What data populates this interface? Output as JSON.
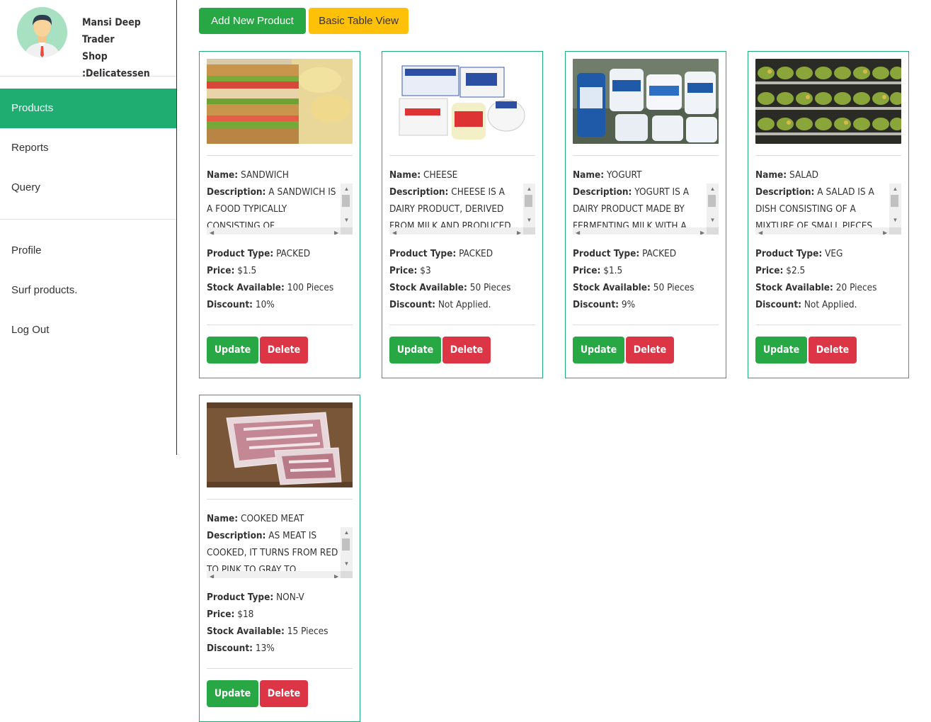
{
  "user": {
    "name": "Mansi Deep",
    "role": "Trader",
    "shop": "Shop :Delicatessen"
  },
  "nav": {
    "main": [
      {
        "label": "Products",
        "active": true
      },
      {
        "label": "Reports",
        "active": false
      },
      {
        "label": "Query",
        "active": false
      }
    ],
    "secondary": [
      {
        "label": "Profile"
      },
      {
        "label": "Surf products."
      },
      {
        "label": "Log Out"
      }
    ]
  },
  "toolbar": {
    "add_label": "Add New Product",
    "table_label": "Basic Table View"
  },
  "labels": {
    "name": "Name:",
    "description": "Description:",
    "type": "Product Type:",
    "price": "Price:",
    "stock": "Stock Available:",
    "discount": "Discount:",
    "update": "Update",
    "delete": "Delete"
  },
  "products": [
    {
      "name": "SANDWICH",
      "description": "A SANDWICH IS A FOOD TYPICALLY CONSISTING OF",
      "type": "PACKED",
      "price": "$1.5",
      "stock": "100 Pieces",
      "discount": "10%",
      "image": "sandwich-photo"
    },
    {
      "name": "CHEESE",
      "description": "CHEESE IS A DAIRY PRODUCT, DERIVED FROM MILK AND PRODUCED",
      "type": "PACKED",
      "price": "$3",
      "stock": "50 Pieces",
      "discount": "Not Applied.",
      "image": "cheese-photo"
    },
    {
      "name": "YOGURT",
      "description": "YOGURT IS A DAIRY PRODUCT MADE BY FERMENTING MILK WITH A",
      "type": "PACKED",
      "price": "$1.5",
      "stock": "50 Pieces",
      "discount": "9%",
      "image": "yogurt-photo"
    },
    {
      "name": "SALAD",
      "description": "A SALAD IS A DISH CONSISTING OF A MIXTURE OF SMALL PIECES",
      "type": "VEG",
      "price": "$2.5",
      "stock": "20 Pieces",
      "discount": "Not Applied.",
      "image": "salad-photo"
    },
    {
      "name": "COOKED MEAT",
      "description": "AS MEAT IS COOKED, IT TURNS FROM RED TO PINK TO GRAY TO",
      "type": "NON-V",
      "price": "$18",
      "stock": "15 Pieces",
      "discount": "13%",
      "image": "meat-photo"
    }
  ]
}
